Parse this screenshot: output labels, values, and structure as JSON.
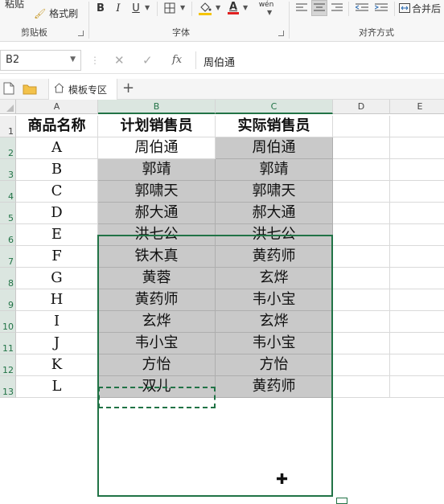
{
  "ribbon": {
    "paste_label": "粘贴",
    "format_painter_label": "格式刷",
    "clipboard_group": "剪贴板",
    "font_group": "字体",
    "align_group": "对齐方式",
    "bold": "B",
    "italic": "I",
    "underline": "U",
    "font_color_glyph": "A",
    "phonetic_glyph": "wén",
    "merge_label": "合并后",
    "accent_color": "#217346",
    "font_color_bar": "#e02020",
    "fill_color_bar": "#f5c400"
  },
  "formula_bar": {
    "name_box": "B2",
    "formula": "周伯通"
  },
  "tabs": {
    "template_tab": "模板专区",
    "add_tab": "+"
  },
  "columns": [
    "A",
    "B",
    "C",
    "D",
    "E"
  ],
  "rows": [
    "1",
    "2",
    "3",
    "4",
    "5",
    "6",
    "7",
    "8",
    "9",
    "10",
    "11",
    "12",
    "13"
  ],
  "table": {
    "headers": [
      "商品名称",
      "计划销售员",
      "实际销售员"
    ],
    "data": [
      [
        "A",
        "周伯通",
        "周伯通"
      ],
      [
        "B",
        "郭靖",
        "郭靖"
      ],
      [
        "C",
        "郭啸天",
        "郭啸天"
      ],
      [
        "D",
        "郝大通",
        "郝大通"
      ],
      [
        "E",
        "洪七公",
        "洪七公"
      ],
      [
        "F",
        "铁木真",
        "黄药师"
      ],
      [
        "G",
        "黄蓉",
        "玄烨"
      ],
      [
        "H",
        "黄药师",
        "韦小宝"
      ],
      [
        "I",
        "玄烨",
        "玄烨"
      ],
      [
        "J",
        "韦小宝",
        "韦小宝"
      ],
      [
        "K",
        "方怡",
        "方怡"
      ],
      [
        "L",
        "双儿",
        "黄药师"
      ]
    ]
  }
}
